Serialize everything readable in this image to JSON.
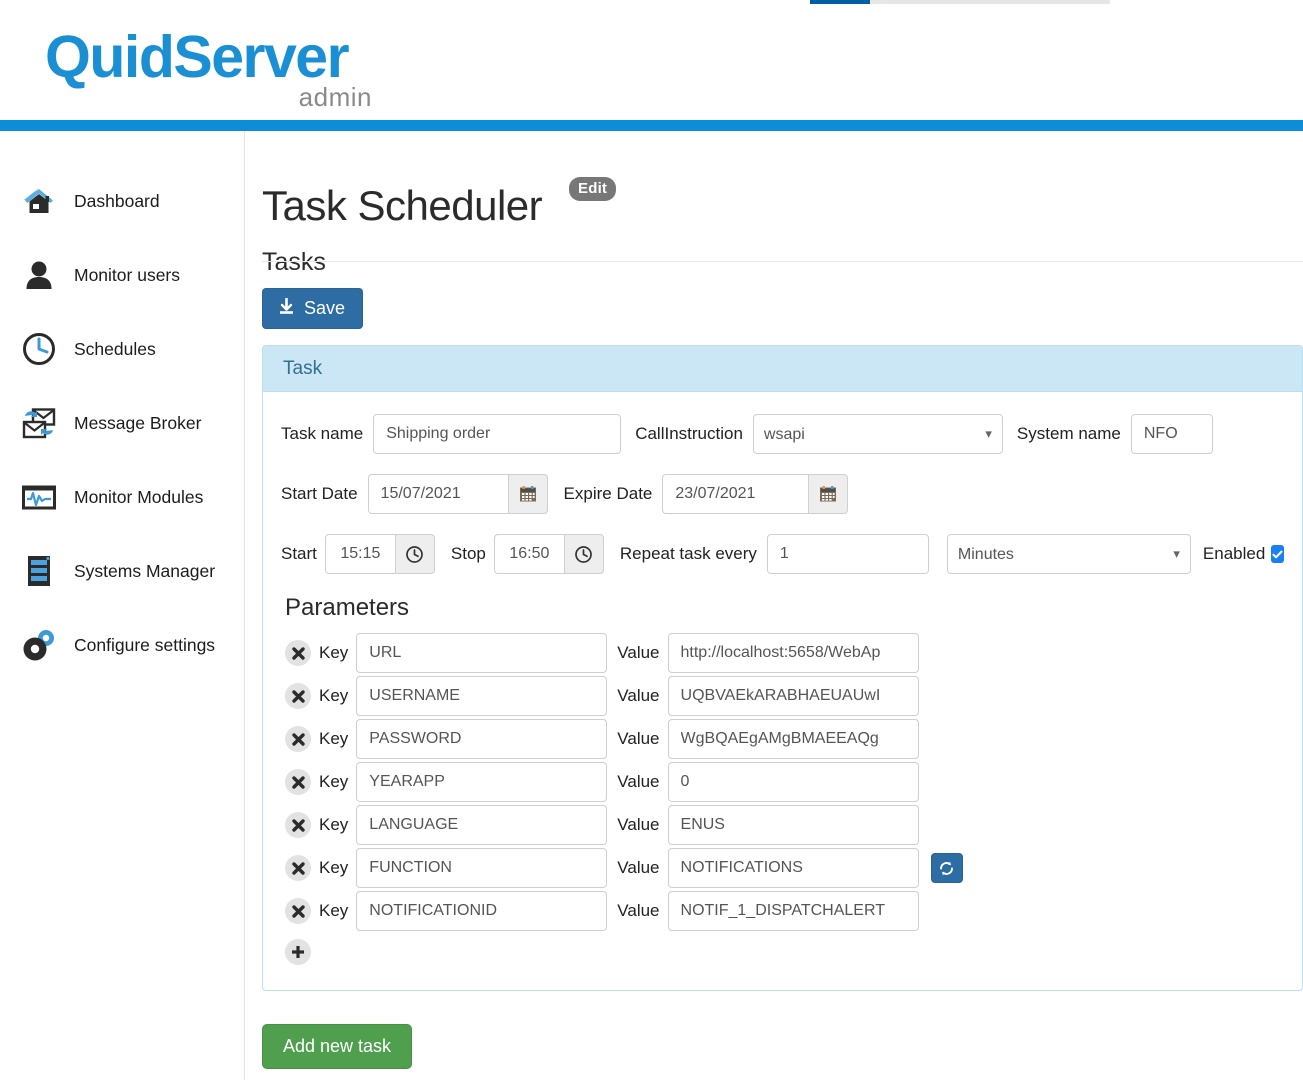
{
  "brand": {
    "logo_main": "QuidServer",
    "logo_sub": "admin"
  },
  "colors": {
    "brand_blue": "#0d8dd8",
    "logo_blue": "#1b8fd4",
    "panel_header": "#cbe6f5",
    "panel_border": "#b9dff0",
    "save_button": "#2e6da4",
    "add_button": "#4f9f4f",
    "badge_gray": "#777777",
    "checkbox_blue": "#1a7ff0",
    "top_strip_blue": "#005fa3",
    "top_strip_gray": "#e7e7e7"
  },
  "sidebar": {
    "items": [
      {
        "label": "Dashboard",
        "icon": "home-icon"
      },
      {
        "label": "Monitor users",
        "icon": "user-icon"
      },
      {
        "label": "Schedules",
        "icon": "clock-icon"
      },
      {
        "label": "Message Broker",
        "icon": "envelope-sync-icon"
      },
      {
        "label": "Monitor Modules",
        "icon": "waveform-monitor-icon"
      },
      {
        "label": "Systems Manager",
        "icon": "server-rack-icon"
      },
      {
        "label": "Configure settings",
        "icon": "gears-icon"
      }
    ]
  },
  "main": {
    "page_title": "Task Scheduler",
    "edit_badge": "Edit",
    "sub_title": "Tasks",
    "save_label": "Save",
    "add_task_label": "Add new task"
  },
  "task_panel": {
    "header": "Task",
    "fields": {
      "task_name_label": "Task name",
      "task_name_value": "Shipping order",
      "call_instruction_label": "CallInstruction",
      "call_instruction_value": "wsapi",
      "call_instruction_options": [
        "wsapi"
      ],
      "system_name_label": "System name",
      "system_name_value": "NFO",
      "start_date_label": "Start Date",
      "start_date_value": "15/07/2021",
      "expire_date_label": "Expire Date",
      "expire_date_value": "23/07/2021",
      "start_label": "Start",
      "start_time_value": "15:15",
      "stop_label": "Stop",
      "stop_time_value": "16:50",
      "repeat_label": "Repeat task every",
      "repeat_value": "1",
      "repeat_unit_value": "Minutes",
      "repeat_unit_options": [
        "Minutes"
      ],
      "enabled_label": "Enabled",
      "enabled_checked": true
    },
    "parameters_title": "Parameters",
    "key_label": "Key",
    "value_label": "Value",
    "parameters": [
      {
        "key": "URL",
        "value": "http://localhost:5658/WebAp",
        "has_refresh": false
      },
      {
        "key": "USERNAME",
        "value": "UQBVAEkARABHAEUAUwI",
        "has_refresh": false
      },
      {
        "key": "PASSWORD",
        "value": "WgBQAEgAMgBMAEEAQg",
        "has_refresh": false
      },
      {
        "key": "YEARAPP",
        "value": "0",
        "has_refresh": false
      },
      {
        "key": "LANGUAGE",
        "value": "ENUS",
        "has_refresh": false
      },
      {
        "key": "FUNCTION",
        "value": "NOTIFICATIONS",
        "has_refresh": true
      },
      {
        "key": "NOTIFICATIONID",
        "value": "NOTIF_1_DISPATCHALERT",
        "has_refresh": false
      }
    ]
  }
}
